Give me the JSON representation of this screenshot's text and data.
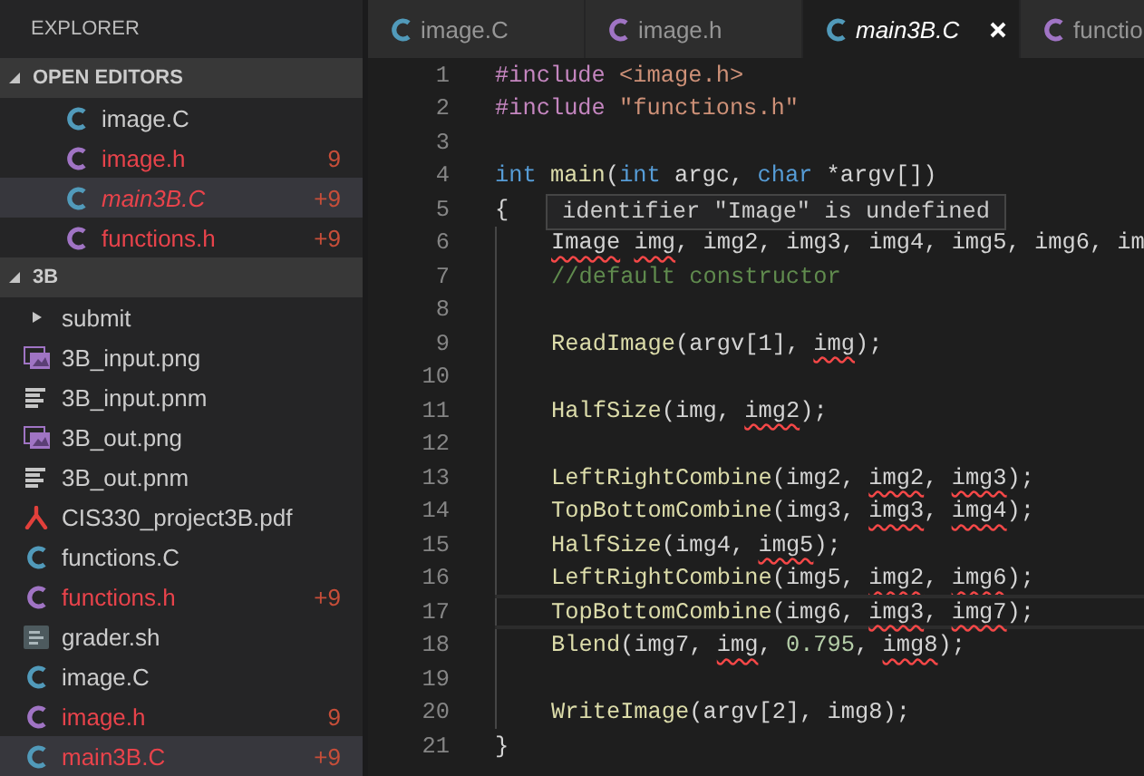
{
  "sidebar": {
    "title": "EXPLORER",
    "sections": [
      {
        "label": "OPEN EDITORS",
        "expanded": true,
        "items": [
          {
            "name": "image.C",
            "kind": "c-source",
            "modified": false,
            "preview": false,
            "selected": false
          },
          {
            "name": "image.h",
            "kind": "c-header",
            "modified": true,
            "badge": "9",
            "preview": false,
            "selected": false
          },
          {
            "name": "main3B.C",
            "kind": "c-source",
            "modified": true,
            "badge": "+9",
            "preview": true,
            "selected": true
          },
          {
            "name": "functions.h",
            "kind": "c-header",
            "modified": true,
            "badge": "+9",
            "preview": false,
            "selected": false
          }
        ]
      },
      {
        "label": "3B",
        "expanded": true,
        "items": [
          {
            "name": "submit",
            "kind": "folder",
            "expanded": false,
            "modified": false,
            "preview": false,
            "selected": false
          },
          {
            "name": "3B_input.png",
            "kind": "image",
            "modified": false,
            "preview": false,
            "selected": false
          },
          {
            "name": "3B_input.pnm",
            "kind": "text",
            "modified": false,
            "preview": false,
            "selected": false
          },
          {
            "name": "3B_out.png",
            "kind": "image",
            "modified": false,
            "preview": false,
            "selected": false
          },
          {
            "name": "3B_out.pnm",
            "kind": "text",
            "modified": false,
            "preview": false,
            "selected": false
          },
          {
            "name": "CIS330_project3B.pdf",
            "kind": "pdf",
            "modified": false,
            "preview": false,
            "selected": false
          },
          {
            "name": "functions.C",
            "kind": "c-source",
            "modified": false,
            "preview": false,
            "selected": false
          },
          {
            "name": "functions.h",
            "kind": "c-header",
            "modified": true,
            "badge": "+9",
            "preview": false,
            "selected": false
          },
          {
            "name": "grader.sh",
            "kind": "shell",
            "modified": false,
            "preview": false,
            "selected": false
          },
          {
            "name": "image.C",
            "kind": "c-source",
            "modified": false,
            "preview": false,
            "selected": false
          },
          {
            "name": "image.h",
            "kind": "c-header",
            "modified": true,
            "badge": "9",
            "preview": false,
            "selected": false
          },
          {
            "name": "main3B.C",
            "kind": "c-source",
            "modified": true,
            "badge": "+9",
            "preview": false,
            "selected": true
          }
        ]
      }
    ]
  },
  "tabs": [
    {
      "label": "image.C",
      "kind": "c-source",
      "selected": false,
      "preview": false
    },
    {
      "label": "image.h",
      "kind": "c-header",
      "selected": false,
      "preview": false
    },
    {
      "label": "main3B.C",
      "kind": "c-source",
      "selected": true,
      "preview": true
    },
    {
      "label": "functio",
      "kind": "c-header",
      "selected": false,
      "preview": false
    }
  ],
  "editor": {
    "lines": [
      {
        "number": "1",
        "indented": false,
        "current": false,
        "tokens": [
          {
            "text": "#include ",
            "kind": "directive"
          },
          {
            "text": "<image.h>",
            "kind": "string"
          }
        ]
      },
      {
        "number": "2",
        "indented": false,
        "current": false,
        "tokens": [
          {
            "text": "#include ",
            "kind": "directive"
          },
          {
            "text": "\"functions.h\"",
            "kind": "string"
          }
        ]
      },
      {
        "number": "3",
        "indented": false,
        "current": false
      },
      {
        "number": "4",
        "indented": false,
        "current": false,
        "tokens": [
          {
            "text": "int ",
            "kind": "keyword"
          },
          {
            "text": "main",
            "kind": "function"
          },
          {
            "text": "(",
            "kind": "plain"
          },
          {
            "text": "int ",
            "kind": "keyword"
          },
          {
            "text": "argc, ",
            "kind": "plain"
          },
          {
            "text": "char ",
            "kind": "keyword"
          },
          {
            "text": "*argv[])",
            "kind": "plain"
          }
        ]
      },
      {
        "number": "5",
        "indented": false,
        "current": false,
        "tokens": [
          {
            "text": "{",
            "kind": "plain"
          }
        ]
      },
      {
        "number": "6",
        "indented": true,
        "current": false,
        "tokens": [
          {
            "text": "Image ",
            "kind": "undefined"
          },
          {
            "text": "img",
            "kind": "undefined"
          },
          {
            "text": ", img2, img3, img4, img5, img6, im",
            "kind": "plain"
          }
        ]
      },
      {
        "number": "7",
        "indented": true,
        "current": false,
        "tokens": [
          {
            "text": "//default constructor",
            "kind": "comment"
          }
        ]
      },
      {
        "number": "8",
        "indented": true,
        "current": false
      },
      {
        "number": "9",
        "indented": true,
        "current": false,
        "tokens": [
          {
            "text": "ReadImage",
            "kind": "function"
          },
          {
            "text": "(argv[1], ",
            "kind": "plain"
          },
          {
            "text": "img",
            "kind": "undefined"
          },
          {
            "text": ");",
            "kind": "plain"
          }
        ]
      },
      {
        "number": "10",
        "indented": true,
        "current": false
      },
      {
        "number": "11",
        "indented": true,
        "current": false,
        "tokens": [
          {
            "text": "HalfSize",
            "kind": "function"
          },
          {
            "text": "(img, ",
            "kind": "plain"
          },
          {
            "text": "img2",
            "kind": "undefined"
          },
          {
            "text": ");",
            "kind": "plain"
          }
        ]
      },
      {
        "number": "12",
        "indented": true,
        "current": false
      },
      {
        "number": "13",
        "indented": true,
        "current": false,
        "tokens": [
          {
            "text": "LeftRightCombine",
            "kind": "function"
          },
          {
            "text": "(img2, ",
            "kind": "plain"
          },
          {
            "text": "img2",
            "kind": "undefined"
          },
          {
            "text": ", ",
            "kind": "plain"
          },
          {
            "text": "img3",
            "kind": "undefined"
          },
          {
            "text": ");",
            "kind": "plain"
          }
        ]
      },
      {
        "number": "14",
        "indented": true,
        "current": false,
        "tokens": [
          {
            "text": "TopBottomCombine",
            "kind": "function"
          },
          {
            "text": "(img3, ",
            "kind": "plain"
          },
          {
            "text": "img3",
            "kind": "undefined"
          },
          {
            "text": ", ",
            "kind": "plain"
          },
          {
            "text": "img4",
            "kind": "undefined"
          },
          {
            "text": ");",
            "kind": "plain"
          }
        ]
      },
      {
        "number": "15",
        "indented": true,
        "current": false,
        "tokens": [
          {
            "text": "HalfSize",
            "kind": "function"
          },
          {
            "text": "(img4, ",
            "kind": "plain"
          },
          {
            "text": "img5",
            "kind": "undefined"
          },
          {
            "text": ");",
            "kind": "plain"
          }
        ]
      },
      {
        "number": "16",
        "indented": true,
        "current": false,
        "tokens": [
          {
            "text": "LeftRightCombine",
            "kind": "function"
          },
          {
            "text": "(img5, ",
            "kind": "plain"
          },
          {
            "text": "img2",
            "kind": "undefined"
          },
          {
            "text": ", ",
            "kind": "plain"
          },
          {
            "text": "img6",
            "kind": "undefined"
          },
          {
            "text": ");",
            "kind": "plain"
          }
        ]
      },
      {
        "number": "17",
        "indented": true,
        "current": true,
        "tokens": [
          {
            "text": "TopBottomCombine",
            "kind": "function"
          },
          {
            "text": "(img6, ",
            "kind": "plain"
          },
          {
            "text": "img3",
            "kind": "undefined"
          },
          {
            "text": ", ",
            "kind": "plain"
          },
          {
            "text": "img7",
            "kind": "undefined"
          },
          {
            "text": ");",
            "kind": "plain"
          }
        ]
      },
      {
        "number": "18",
        "indented": true,
        "current": false,
        "tokens": [
          {
            "text": "Blend",
            "kind": "function"
          },
          {
            "text": "(img7, ",
            "kind": "plain"
          },
          {
            "text": "img",
            "kind": "undefined"
          },
          {
            "text": ", ",
            "kind": "plain"
          },
          {
            "text": "0.795",
            "kind": "number"
          },
          {
            "text": ", ",
            "kind": "plain"
          },
          {
            "text": "img8",
            "kind": "undefined"
          },
          {
            "text": ");",
            "kind": "plain"
          }
        ]
      },
      {
        "number": "19",
        "indented": true,
        "current": false
      },
      {
        "number": "20",
        "indented": true,
        "current": false,
        "tokens": [
          {
            "text": "WriteImage",
            "kind": "function"
          },
          {
            "text": "(argv[2], img8);",
            "kind": "plain"
          }
        ]
      },
      {
        "number": "21",
        "indented": false,
        "current": false,
        "tokens": [
          {
            "text": "}",
            "kind": "plain"
          }
        ]
      }
    ],
    "hover": {
      "text": "identifier \"Image\" is undefined"
    }
  }
}
